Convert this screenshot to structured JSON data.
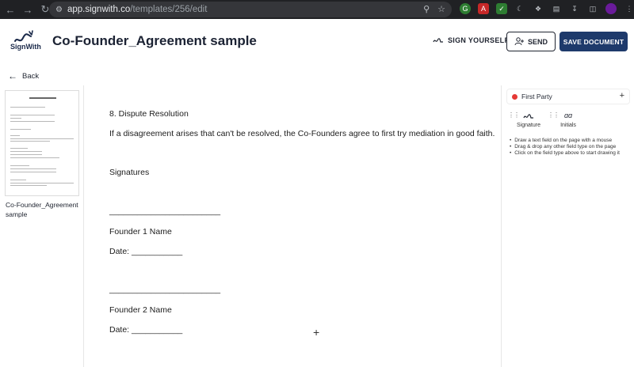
{
  "browser": {
    "url_host": "app.signwith.co",
    "url_path": "/templates/256/edit"
  },
  "header": {
    "logo_text": "SignWith",
    "title": "Co-Founder_Agreement sample",
    "sign_yourself_label": "SIGN YOURSELF",
    "send_label": "SEND",
    "save_label": "SAVE DOCUMENT"
  },
  "nav": {
    "back_label": "Back"
  },
  "thumbnails": [
    {
      "label": "Co-Founder_Agreement sample"
    }
  ],
  "document": {
    "lines": [
      "8. Dispute Resolution",
      "If a disagreement arises that can't be resolved, the Co-Founders agree to first try mediation in good faith.",
      "Signatures",
      "________________________",
      "Founder 1 Name",
      "Date: ___________",
      "________________________",
      "Founder 2 Name",
      "Date: ___________"
    ]
  },
  "right_panel": {
    "party_name": "First Party",
    "party_color": "#e53935",
    "field_types": [
      {
        "label": "Signature",
        "icon": "signature-icon"
      },
      {
        "label": "Initials",
        "icon": "initials-icon"
      }
    ],
    "tips": [
      "Draw a text field on the page with a mouse",
      "Drag & drop any other field type on the page",
      "Click on the field type above to start drawing it"
    ]
  },
  "colors": {
    "primary": "#1e3a6b",
    "chrome": "#202124"
  }
}
